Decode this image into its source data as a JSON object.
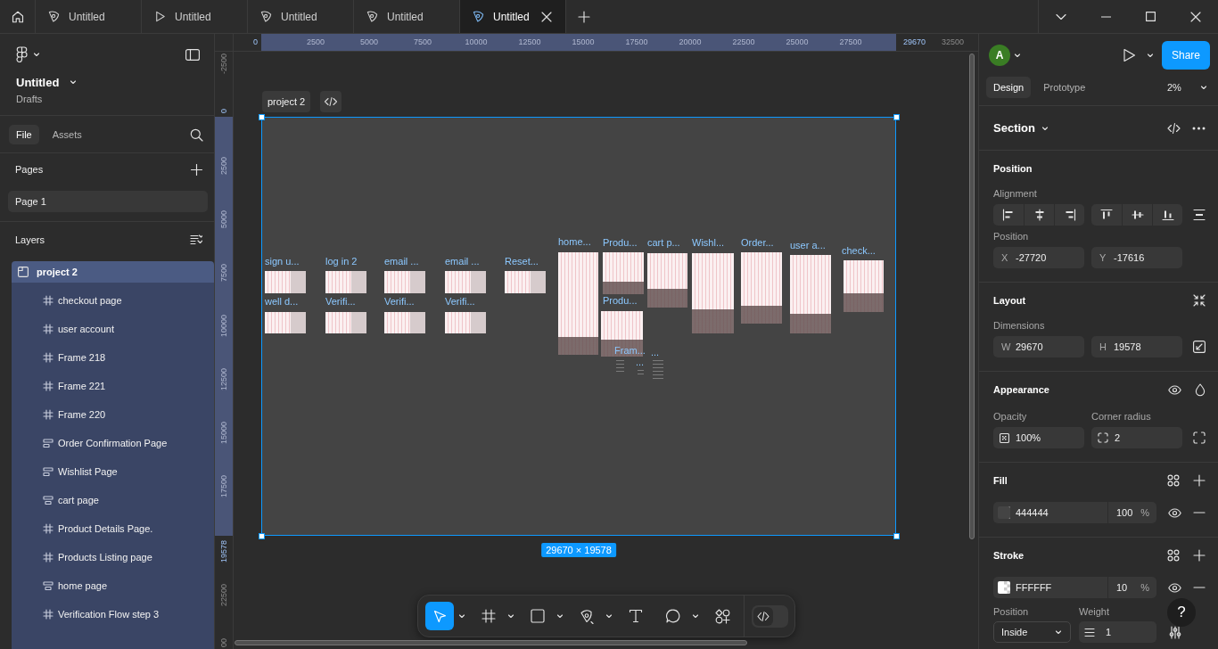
{
  "tab_bar": {
    "tabs": [
      {
        "label": "Untitled",
        "kind": "design",
        "selected": false
      },
      {
        "label": "Untitled",
        "kind": "play",
        "selected": false
      },
      {
        "label": "Untitled",
        "kind": "design",
        "selected": false
      },
      {
        "label": "Untitled",
        "kind": "design",
        "selected": false
      },
      {
        "label": "Untitled",
        "kind": "design",
        "selected": true
      }
    ]
  },
  "left_panel": {
    "file_name": "Untitled",
    "location": "Drafts",
    "tabs": [
      {
        "label": "File",
        "selected": true
      },
      {
        "label": "Assets",
        "selected": false
      }
    ],
    "pages_title": "Pages",
    "pages": [
      {
        "label": "Page 1",
        "selected": true
      }
    ],
    "layers_title": "Layers",
    "layers": [
      {
        "label": "project 2",
        "kind": "section",
        "selected": true,
        "children": [
          {
            "label": "checkout page",
            "kind": "frame",
            "selected": false
          },
          {
            "label": "user account",
            "kind": "frame",
            "selected": false
          },
          {
            "label": "Frame 218",
            "kind": "frame",
            "selected": false
          },
          {
            "label": "Frame 221",
            "kind": "frame",
            "selected": false
          },
          {
            "label": "Frame 220",
            "kind": "frame",
            "selected": false
          },
          {
            "label": "Order Confirmation Page",
            "kind": "stack-left",
            "selected": false
          },
          {
            "label": "Wishlist Page",
            "kind": "stack-left",
            "selected": false
          },
          {
            "label": "cart page",
            "kind": "stack-center",
            "selected": false
          },
          {
            "label": "Product Details Page.",
            "kind": "frame",
            "selected": false
          },
          {
            "label": "Products Listing page",
            "kind": "frame",
            "selected": false
          },
          {
            "label": "home page",
            "kind": "stack-center",
            "selected": false
          },
          {
            "label": "Verification Flow step 3",
            "kind": "frame",
            "selected": false
          }
        ]
      }
    ]
  },
  "rulers": {
    "top": [
      {
        "label": "0",
        "kind": "edge-start"
      },
      {
        "label": "2500",
        "kind": "inside"
      },
      {
        "label": "5000",
        "kind": "inside"
      },
      {
        "label": "7500",
        "kind": "inside"
      },
      {
        "label": "10000",
        "kind": "inside"
      },
      {
        "label": "12500",
        "kind": "inside"
      },
      {
        "label": "15000",
        "kind": "inside"
      },
      {
        "label": "17500",
        "kind": "inside"
      },
      {
        "label": "20000",
        "kind": "inside"
      },
      {
        "label": "22500",
        "kind": "inside"
      },
      {
        "label": "25000",
        "kind": "inside"
      },
      {
        "label": "27500",
        "kind": "inside"
      },
      {
        "label": "29670",
        "kind": "edge-end"
      },
      {
        "label": "32500",
        "kind": "outside"
      }
    ],
    "left": [
      {
        "label": "-2500",
        "kind": "before"
      },
      {
        "label": "0",
        "kind": "edge-start"
      },
      {
        "label": "2500",
        "kind": "inside"
      },
      {
        "label": "5000",
        "kind": "inside"
      },
      {
        "label": "7500",
        "kind": "inside"
      },
      {
        "label": "10000",
        "kind": "inside"
      },
      {
        "label": "12500",
        "kind": "inside"
      },
      {
        "label": "15000",
        "kind": "inside"
      },
      {
        "label": "17500",
        "kind": "inside"
      },
      {
        "label": "19578",
        "kind": "edge-end"
      },
      {
        "label": "22500",
        "kind": "outside"
      },
      {
        "label": "00",
        "kind": "outside"
      }
    ]
  },
  "canvas": {
    "section": {
      "label": "project 2",
      "size": "29670 × 19578",
      "selected": true,
      "frames": [
        {
          "label": "sign u..."
        },
        {
          "label": "log in 2"
        },
        {
          "label": "email ..."
        },
        {
          "label": "email ..."
        },
        {
          "label": "Reset..."
        },
        {
          "label": "well d..."
        },
        {
          "label": "Verifi..."
        },
        {
          "label": "Verifi..."
        },
        {
          "label": "Verifi..."
        },
        {
          "label": "home..."
        },
        {
          "label": "Produ..."
        },
        {
          "label": "cart p..."
        },
        {
          "label": "Wishl..."
        },
        {
          "label": "Order..."
        },
        {
          "label": "user a..."
        },
        {
          "label": "check..."
        },
        {
          "label": "Produ..."
        },
        {
          "label": "Fram..."
        },
        {
          "label": "..."
        },
        {
          "label": "..."
        }
      ]
    }
  },
  "toolbar": {
    "tools": [
      {
        "kind": "move",
        "selected": true,
        "menu": true
      },
      {
        "kind": "frame",
        "selected": false,
        "menu": true
      },
      {
        "kind": "shape",
        "selected": false,
        "menu": true
      },
      {
        "kind": "pen",
        "selected": false,
        "menu": true
      },
      {
        "kind": "text",
        "selected": false,
        "menu": false
      },
      {
        "kind": "comment",
        "selected": false,
        "menu": true
      },
      {
        "kind": "actions",
        "selected": false,
        "menu": false
      }
    ],
    "dev_mode": {
      "on": false
    }
  },
  "right_panel": {
    "avatar_initial": "A",
    "share": "Share",
    "tabs": [
      {
        "label": "Design",
        "selected": true
      },
      {
        "label": "Prototype",
        "selected": false
      }
    ],
    "zoom": "2%",
    "selection_type": "Section",
    "position": {
      "title": "Position",
      "alignment_label": "Alignment",
      "position_label": "Position",
      "x": {
        "label": "X",
        "value": "-27720"
      },
      "y": {
        "label": "Y",
        "value": "-17616"
      }
    },
    "layout": {
      "title": "Layout",
      "dimensions_label": "Dimensions",
      "w": {
        "label": "W",
        "value": "29670"
      },
      "h": {
        "label": "H",
        "value": "19578"
      }
    },
    "appearance": {
      "title": "Appearance",
      "opacity_label": "Opacity",
      "opacity": "100%",
      "corner_radius_label": "Corner radius",
      "corner_radius": "2"
    },
    "fill": {
      "title": "Fill",
      "items": [
        {
          "hex": "444444",
          "color": "#444444",
          "opacity": "100",
          "unit": "%"
        }
      ]
    },
    "stroke": {
      "title": "Stroke",
      "items": [
        {
          "hex": "FFFFFF",
          "color": "#ffffff",
          "opacity": "10",
          "unit": "%"
        }
      ],
      "position_label": "Position",
      "position": "Inside",
      "weight_label": "Weight",
      "weight": "1"
    }
  },
  "help_button": {
    "label": "?"
  }
}
